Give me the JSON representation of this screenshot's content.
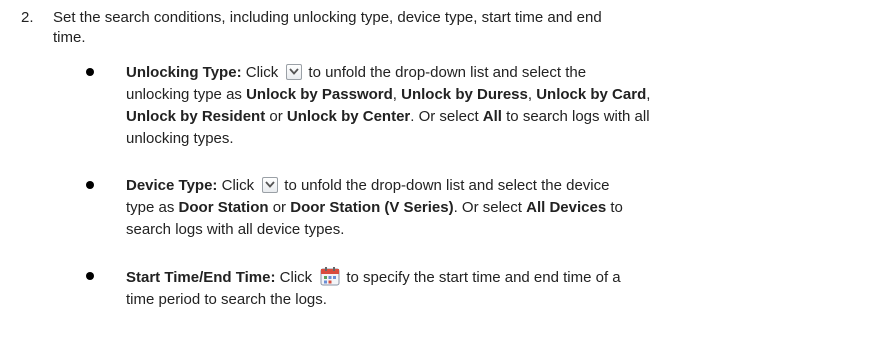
{
  "step": {
    "number": "2.",
    "text_line1": "Set the search conditions, including unlocking type, device type, start time and end",
    "text_line2": "time."
  },
  "bullets": {
    "unlocking": {
      "label": "Unlocking Type:",
      "t1": "Click",
      "t2": "to unfold the drop-down list and select the",
      "t3": "unlocking type as",
      "o1": "Unlock by Password",
      "c1": ",",
      "o2": "Unlock by Duress",
      "c2": ",",
      "o3": "Unlock by Card",
      "c3": ",",
      "o4": "Unlock by Resident",
      "or": "or",
      "o5": "Unlock by Center",
      "t4": ". Or select",
      "all": "All",
      "t5": "to search logs with all",
      "t6": "unlocking types.",
      "icon": "dropdown-arrow-icon"
    },
    "device": {
      "label": "Device Type:",
      "t1": "Click",
      "t2": "to unfold the drop-down list and select the device",
      "t3": "type as",
      "o1": "Door Station",
      "or": "or",
      "o2": "Door Station (V Series)",
      "t4": ". Or select",
      "all": "All Devices",
      "t5": "to",
      "t6": "search logs with all device types.",
      "icon": "dropdown-arrow-icon"
    },
    "time": {
      "label": "Start Time/End Time:",
      "t1": "Click",
      "t2": "to specify the start time and end time of a",
      "t3": "time period to search the logs.",
      "icon": "calendar-icon"
    }
  }
}
